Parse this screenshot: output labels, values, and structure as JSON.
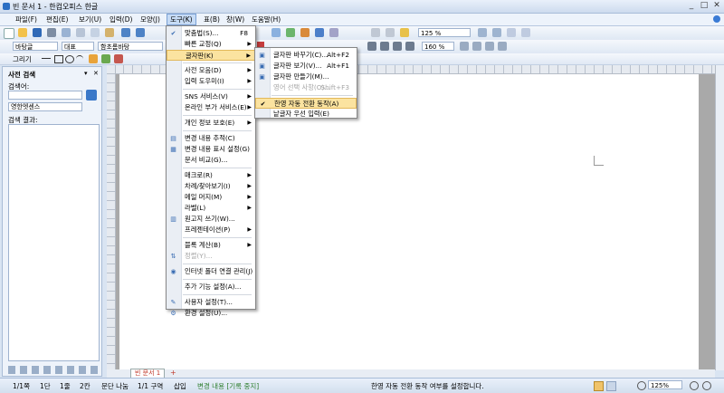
{
  "window": {
    "title": "빈 문서 1 - 한컴오피스 한글",
    "controls": [
      "_",
      "□",
      "✕"
    ]
  },
  "menubar": {
    "items": [
      "파일(F)",
      "편집(E)",
      "보기(U)",
      "입력(D)",
      "모양(J)",
      "도구(K)",
      "표(B)",
      "창(W)",
      "도움말(H)"
    ],
    "active_index": 5
  },
  "toolbar": {
    "zoom": "125 %",
    "spacing": "160 %",
    "style": "바탕글",
    "font_type": "대표",
    "font": "함초롬바탕",
    "draw_label": "그리기"
  },
  "side_panel": {
    "title": "사전 검색",
    "search_label": "검색어:",
    "search_value": "",
    "dictionary": "영한엣센스",
    "results_label": "검색 결과:",
    "close": "✕",
    "pin": "▾"
  },
  "tools_menu": {
    "items": [
      {
        "label": "맞춤법(S)...",
        "shortcut": "F8",
        "icon": "spellcheck-icon",
        "glyph": "✔"
      },
      {
        "label": "빠른 교정(Q)",
        "submenu": true
      },
      {
        "label": "글자판(K)",
        "submenu": true,
        "highlighted": true
      },
      {
        "sep": true
      },
      {
        "label": "사전 모음(D)",
        "submenu": true
      },
      {
        "label": "입력 도우미(I)",
        "submenu": true
      },
      {
        "sep": true
      },
      {
        "label": "SNS 서비스(V)",
        "submenu": true
      },
      {
        "label": "온라인 부가 서비스(E)",
        "submenu": true
      },
      {
        "sep": true
      },
      {
        "label": "개인 정보 보호(E)",
        "submenu": true
      },
      {
        "sep": true
      },
      {
        "label": "변경 내용 추적(C)",
        "icon": "track-changes-icon",
        "glyph": "▤"
      },
      {
        "label": "변경 내용 표시 설정(G)",
        "icon": "track-settings-icon",
        "glyph": "▦"
      },
      {
        "label": "문서 비교(G)..."
      },
      {
        "sep": true
      },
      {
        "label": "매크로(R)",
        "submenu": true
      },
      {
        "label": "차례/찾아보기(I)",
        "submenu": true
      },
      {
        "label": "메일 머지(M)",
        "submenu": true
      },
      {
        "label": "라벨(L)",
        "submenu": true
      },
      {
        "label": "원고지 쓰기(W)...",
        "icon": "manuscript-icon",
        "glyph": "▥"
      },
      {
        "label": "프레젠테이션(P)",
        "submenu": true
      },
      {
        "sep": true
      },
      {
        "label": "블록 계산(B)",
        "submenu": true
      },
      {
        "label": "정렬(Y)...",
        "disabled": true,
        "icon": "sort-icon",
        "glyph": "⇅"
      },
      {
        "sep": true
      },
      {
        "label": "인터넷 폴더 연결 관리(J)",
        "icon": "internet-folder-icon",
        "glyph": "◉"
      },
      {
        "sep": true
      },
      {
        "label": "추가 기능 설정(A)..."
      },
      {
        "sep": true
      },
      {
        "label": "사용자 설정(T)...",
        "icon": "user-settings-icon",
        "glyph": "✎"
      },
      {
        "label": "환경 설정(U)...",
        "icon": "preferences-icon",
        "glyph": "⚙"
      }
    ]
  },
  "keyboard_submenu": {
    "items": [
      {
        "label": "글자판 바꾸기(C)...",
        "shortcut": "Alt+F2",
        "icon": "keyboard-switch-icon",
        "glyph": "▣"
      },
      {
        "label": "글자판 보기(V)...",
        "shortcut": "Alt+F1",
        "icon": "keyboard-view-icon",
        "glyph": "▣"
      },
      {
        "label": "글자판 만들기(M)...",
        "icon": "keyboard-make-icon",
        "glyph": "▣"
      },
      {
        "label": "영어 선택 사항(O)...",
        "shortcut": "Shift+F3",
        "disabled": true
      },
      {
        "sep": true
      },
      {
        "label": "한영 자동 전환 동작(A)",
        "checked": true,
        "highlighted": true,
        "glyph": "✔"
      },
      {
        "label": "낱글자 우선 입력(E)"
      }
    ]
  },
  "doc_tabs": {
    "tab": "빈 문서 1",
    "add": "+"
  },
  "statusbar": {
    "page": "1/1쪽",
    "section": "1단",
    "line": "1줄",
    "col": "2칸",
    "para": "문단 나눔",
    "zone": "1/1 구역",
    "mode": "삽입",
    "track": "변경 내용 [기록 중지]",
    "message": "한영 자동 전환 동작 여부를 설정합니다.",
    "zoom": "125%"
  }
}
